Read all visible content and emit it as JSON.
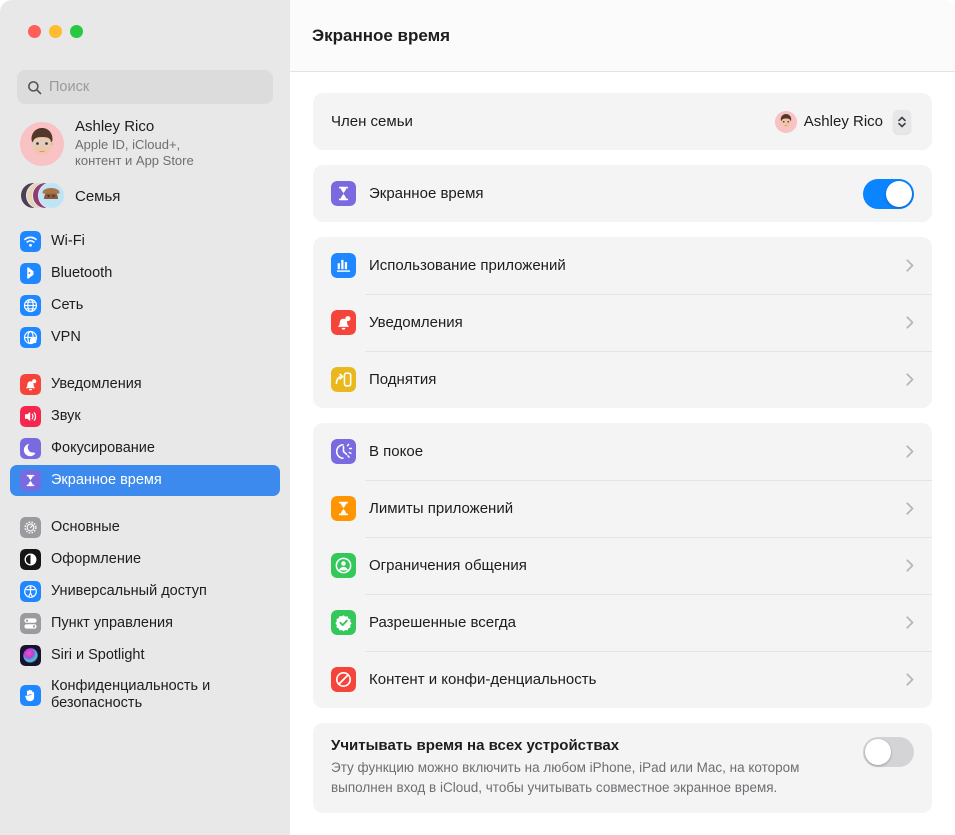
{
  "window": {
    "traffic_lights": [
      "close",
      "minimize",
      "zoom"
    ]
  },
  "sidebar": {
    "search": {
      "placeholder": "Поиск",
      "value": "",
      "icon": "search-icon"
    },
    "profile": {
      "name": "Ashley Rico",
      "subtitle_line1": "Apple ID, iCloud+,",
      "subtitle_line2": "контент и App Store",
      "avatar": "memoji-avatar"
    },
    "family": {
      "label": "Семья",
      "icon": "family-avatars-icon"
    },
    "groups": [
      {
        "items": [
          {
            "label": "Wi-Fi",
            "icon": "wifi-icon",
            "selected": false
          },
          {
            "label": "Bluetooth",
            "icon": "bluetooth-icon",
            "selected": false
          },
          {
            "label": "Сеть",
            "icon": "network-globe-icon",
            "selected": false
          },
          {
            "label": "VPN",
            "icon": "vpn-globe-icon",
            "selected": false
          }
        ]
      },
      {
        "items": [
          {
            "label": "Уведомления",
            "icon": "notifications-bell-icon",
            "selected": false
          },
          {
            "label": "Звук",
            "icon": "sound-speaker-icon",
            "selected": false
          },
          {
            "label": "Фокусирование",
            "icon": "focus-moon-icon",
            "selected": false
          },
          {
            "label": "Экранное время",
            "icon": "screen-time-hourglass-icon",
            "selected": true
          }
        ]
      },
      {
        "items": [
          {
            "label": "Основные",
            "icon": "general-gear-icon",
            "selected": false
          },
          {
            "label": "Оформление",
            "icon": "appearance-icon",
            "selected": false
          },
          {
            "label": "Универсальный доступ",
            "icon": "accessibility-icon",
            "selected": false
          },
          {
            "label": "Пункт управления",
            "icon": "control-center-icon",
            "selected": false
          },
          {
            "label": "Siri и Spotlight",
            "icon": "siri-icon",
            "selected": false
          },
          {
            "label": "Конфиденциальность и безопасность",
            "icon": "privacy-hand-icon",
            "selected": false
          }
        ]
      }
    ]
  },
  "main": {
    "title": "Экранное время",
    "family_member_row": {
      "label": "Член семьи",
      "selected_value": "Ashley Rico",
      "avatar": "memoji-avatar",
      "control": "popup-button"
    },
    "screen_time_row": {
      "label": "Экранное время",
      "icon": "screen-time-hourglass-icon",
      "toggle_state": "on"
    },
    "group_usage": [
      {
        "label": "Использование приложений",
        "icon": "app-usage-chart-icon"
      },
      {
        "label": "Уведомления",
        "icon": "notifications-bell-icon"
      },
      {
        "label": "Поднятия",
        "icon": "pickups-icon"
      }
    ],
    "group_limits": [
      {
        "label": "В покое",
        "icon": "downtime-clock-icon"
      },
      {
        "label": "Лимиты приложений",
        "icon": "app-limits-hourglass-icon"
      },
      {
        "label": "Ограничения общения",
        "icon": "communication-limits-icon"
      },
      {
        "label": "Разрешенные всегда",
        "icon": "always-allowed-icon"
      },
      {
        "label": "Контент и конфи-денциальность",
        "icon": "content-privacy-icon"
      }
    ],
    "share_across_devices": {
      "title": "Учитывать время на всех устройствах",
      "description": "Эту функцию можно включить на любом iPhone, iPad или Mac, на котором выполнен вход в iCloud, чтобы учитывать совместное экранное время.",
      "toggle_state": "off"
    }
  },
  "colors": {
    "accent_blue": "#0a84ff",
    "sidebar_selected": "#3c8aee",
    "sidebar_bg": "#e8e8e8",
    "card_bg": "#f4f4f5",
    "screen_time_purple": "#7a6ae0",
    "red": "#ff3b30",
    "green": "#34c759",
    "orange": "#ff9500",
    "yellow": "#e8b81c"
  }
}
